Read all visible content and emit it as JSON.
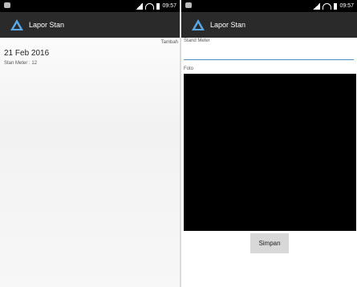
{
  "status_bar": {
    "time": "09:57"
  },
  "app": {
    "title": "Lapor Stan"
  },
  "list_screen": {
    "add_link": "Tambah",
    "entry": {
      "date": "21 Feb 2016",
      "meter_label": "Stan Meter :",
      "meter_value": "12"
    }
  },
  "form_screen": {
    "stand_meter_label": "Stand Meter",
    "stand_meter_value": "",
    "foto_label": "Foto",
    "save_label": "Simpan"
  },
  "colors": {
    "statusbar": "#000000",
    "actionbar": "#2a2a2a",
    "logo": "#5aa7e6",
    "input_underline": "#4f8fbf"
  },
  "icons": [
    "notification-icon",
    "signal-icon",
    "wifi-icon",
    "battery-icon",
    "app-logo-icon"
  ]
}
